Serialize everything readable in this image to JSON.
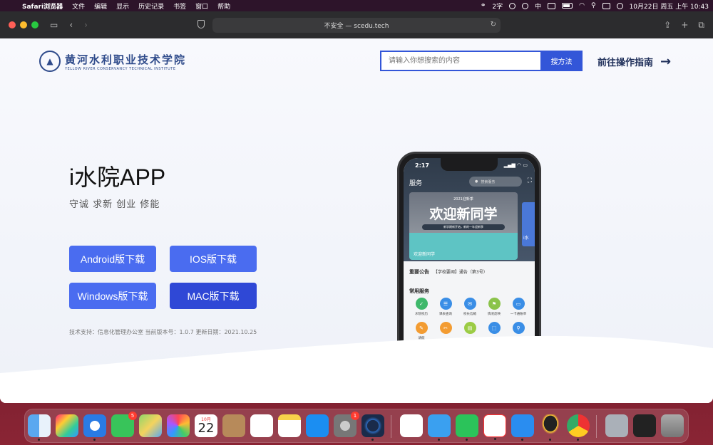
{
  "menubar": {
    "apple": "",
    "items": [
      "Safari浏览器",
      "文件",
      "编辑",
      "显示",
      "历史记录",
      "书签",
      "窗口",
      "帮助"
    ],
    "ime": "2字",
    "ime_lang": "中",
    "datetime": "10月22日 周五 上午 10:43"
  },
  "browser": {
    "address": "不安全 — scedu.tech"
  },
  "site": {
    "logo_cn": "黄河水利职业技术学院",
    "logo_en": "YELLOW RIVER CONSERVANCY TECHNICAL INSTITUTE",
    "search_placeholder": "请输入你想搜索的内容",
    "search_button": "搜方法",
    "guide_link": "前往操作指南",
    "guide_arrow": "→",
    "hero_title": "i水院APP",
    "hero_subtitle": "守诚 求新 创业 修能",
    "buttons": {
      "android": "Android版下载",
      "ios": "IOS版下载",
      "windows": "Windows版下载",
      "mac": "MAC版下载"
    },
    "footer_note": "技术支持：信息化管理办公室 当前版本号：1.0.7 更新日期：2021.10.25"
  },
  "phone": {
    "time": "2:17",
    "status": "▂▄▆ ◠ ▭",
    "services_title": "服务",
    "search_placeholder": "搜索服务",
    "banner_year": "2021迎新季",
    "banner_big": "欢迎新同学",
    "banner_tag": "新学期新开始，新的一年迎新季",
    "banner_label": "欢迎新同学",
    "banner2_label": "i水",
    "notice_title": "重要公告",
    "notice_text": "【学校要闻】通告（第3号）",
    "common_title": "常用服务",
    "services": [
      {
        "label": "水院校历",
        "color": "#3fb86b",
        "glyph": "✓"
      },
      {
        "label": "课表查询",
        "color": "#3a8ee6",
        "glyph": "☰"
      },
      {
        "label": "校长信箱",
        "color": "#3a8ee6",
        "glyph": "✉"
      },
      {
        "label": "情况反映",
        "color": "#8bc34a",
        "glyph": "⚑"
      },
      {
        "label": "一卡通账单",
        "color": "#3a8ee6",
        "glyph": "▭"
      },
      {
        "label": "请假",
        "color": "#f39c32",
        "glyph": "✎"
      },
      {
        "label": "",
        "color": "#f39c32",
        "glyph": "✂"
      },
      {
        "label": "",
        "color": "#9ccc45",
        "glyph": "▤"
      },
      {
        "label": "",
        "color": "#3a8ee6",
        "glyph": "⬚"
      },
      {
        "label": "",
        "color": "#3a8ee6",
        "glyph": "⚲"
      }
    ]
  },
  "dock": {
    "calendar_month": "10月",
    "calendar_day": "22",
    "messages_badge": "5",
    "settings_badge": "1"
  }
}
